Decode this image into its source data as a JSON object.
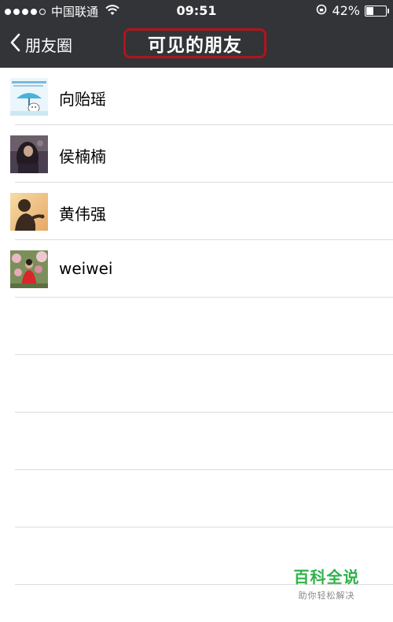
{
  "status_bar": {
    "carrier": "中国联通",
    "time": "09:51",
    "battery_percent": "42%",
    "battery_level": 0.42,
    "signal_bars_filled": 4,
    "signal_bars_total": 5
  },
  "nav": {
    "back_label": "朋友圈",
    "title": "可见的朋友",
    "highlight_color": "#b1141c"
  },
  "friends": [
    {
      "name": "向贻瑶",
      "avatar": "cartoon-umbrella-avatar"
    },
    {
      "name": "侯楠楠",
      "avatar": "portrait-avatar"
    },
    {
      "name": "黄伟强",
      "avatar": "child-silhouette-avatar"
    },
    {
      "name": "weiwei",
      "avatar": "flowers-photo-avatar"
    }
  ],
  "watermark": {
    "title": "百科全说",
    "subtitle": "助你轻松解决",
    "color": "#2fb34a"
  }
}
